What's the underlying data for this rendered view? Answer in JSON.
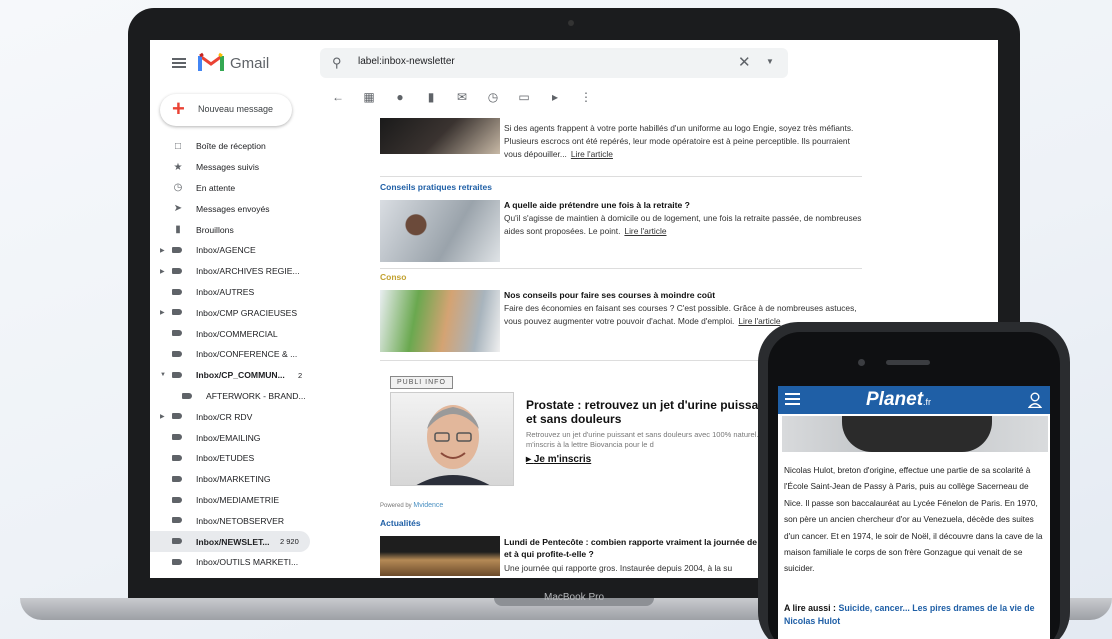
{
  "laptop": {
    "brand": "MacBook Pro"
  },
  "gmail": {
    "title": "Gmail",
    "search": {
      "query": "label:inbox-newsletter"
    },
    "compose_label": "Nouveau message",
    "nav": [
      {
        "label": "Boîte de réception",
        "icon": "inbox-icon"
      },
      {
        "label": "Messages suivis",
        "icon": "star-icon"
      },
      {
        "label": "En attente",
        "icon": "clock-icon"
      },
      {
        "label": "Messages envoyés",
        "icon": "send-icon"
      },
      {
        "label": "Brouillons",
        "icon": "draft-icon"
      },
      {
        "label": "Inbox/AGENCE",
        "icon": "label-icon",
        "expandable": true
      },
      {
        "label": "Inbox/ARCHIVES REGIE...",
        "icon": "label-icon",
        "expandable": true
      },
      {
        "label": "Inbox/AUTRES",
        "icon": "label-icon"
      },
      {
        "label": "Inbox/CMP GRACIEUSES",
        "icon": "label-icon",
        "expandable": true
      },
      {
        "label": "Inbox/COMMERCIAL",
        "icon": "label-icon"
      },
      {
        "label": "Inbox/CONFERENCE & ...",
        "icon": "label-icon"
      },
      {
        "label": "Inbox/CP_COMMUN...",
        "icon": "label-icon",
        "count": "2",
        "bold": true,
        "expanded": true
      },
      {
        "label": "AFTERWORK - BRAND...",
        "icon": "label-icon",
        "sub": true
      },
      {
        "label": "Inbox/CR RDV",
        "icon": "label-icon",
        "expandable": true
      },
      {
        "label": "Inbox/EMAILING",
        "icon": "label-icon"
      },
      {
        "label": "Inbox/ETUDES",
        "icon": "label-icon"
      },
      {
        "label": "Inbox/MARKETING",
        "icon": "label-icon"
      },
      {
        "label": "Inbox/MEDIAMETRIE",
        "icon": "label-icon"
      },
      {
        "label": "Inbox/NETOBSERVER",
        "icon": "label-icon"
      },
      {
        "label": "Inbox/NEWSLET...",
        "icon": "label-icon",
        "count": "2 920",
        "bold": true,
        "active": true
      },
      {
        "label": "Inbox/OUTILS MARKETI...",
        "icon": "label-icon"
      }
    ],
    "toolbar": [
      "back-icon",
      "archive-icon",
      "report-spam-icon",
      "delete-icon",
      "mark-unread-icon",
      "snooze-icon",
      "move-to-icon",
      "label-icon",
      "more-icon"
    ]
  },
  "newsletter": {
    "article1": {
      "text": "Si des agents frappent à votre porte habillés d'un uniforme au logo Engie, soyez très méfiants. Plusieurs escrocs ont été repérés, leur mode opératoire est à peine perceptible. Ils pourraient vous dépouiller...",
      "link": "Lire l'article"
    },
    "section2": {
      "label": "Conseils pratiques retraites",
      "color": "#1f5fa6"
    },
    "article2": {
      "title": "A quelle aide prétendre une fois à la retraite ?",
      "text": "Qu'il s'agisse de maintien à domicile ou de logement, une fois la retraite passée, de nombreuses aides sont proposées. Le point.",
      "link": "Lire l'article"
    },
    "section3": {
      "label": "Conso",
      "color": "#c2a130"
    },
    "article3": {
      "title": "Nos conseils pour faire ses courses à moindre coût",
      "text": "Faire des économies en faisant ses courses ? C'est possible. Grâce à de nombreuses astuces, vous pouvez augmenter votre pouvoir d'achat. Mode d'emploi.",
      "link": "Lire l'article"
    },
    "publi": {
      "badge": "PUBLI INFO",
      "title": "Prostate : retrouvez un jet d'urine puissant et sans douleurs",
      "text": "Retrouvez un jet d'urine puissant et sans douleurs avec 100% naturel. Je m'inscris à la lettre Biovancia pour le d",
      "cta": "Je m'inscris"
    },
    "powered": {
      "prefix": "Powered by",
      "brand": "Mvidence"
    },
    "section4": {
      "label": "Actualités",
      "color": "#1f5fa6"
    },
    "article4": {
      "title": "Lundi de Pentecôte : combien rapporte vraiment la journée de solidarité et à qui profite-t-elle ?",
      "text": "Une journée qui rapporte gros. Instaurée depuis 2004, à la su"
    }
  },
  "phone": {
    "logo": "Planet",
    "logo_suffix": ".fr",
    "body": "Nicolas Hulot, breton d'origine, effectue une partie de sa scolarité à l'École Saint-Jean de Passy à Paris, puis au collège Sacerneau de Nice. Il passe son baccalauréat au Lycée Fénelon de Paris. En 1970, son père un ancien chercheur d'or au Venezuela, décède des suites d'un cancer. Et en 1974, le soir de Noël, il découvre dans la cave de la maison familiale le corps de son frère Gonzague qui venait de se suicider.",
    "more_prefix": "A lire aussi :",
    "more_link": "Suicide, cancer... Les pires drames de la vie de Nicolas Hulot"
  }
}
